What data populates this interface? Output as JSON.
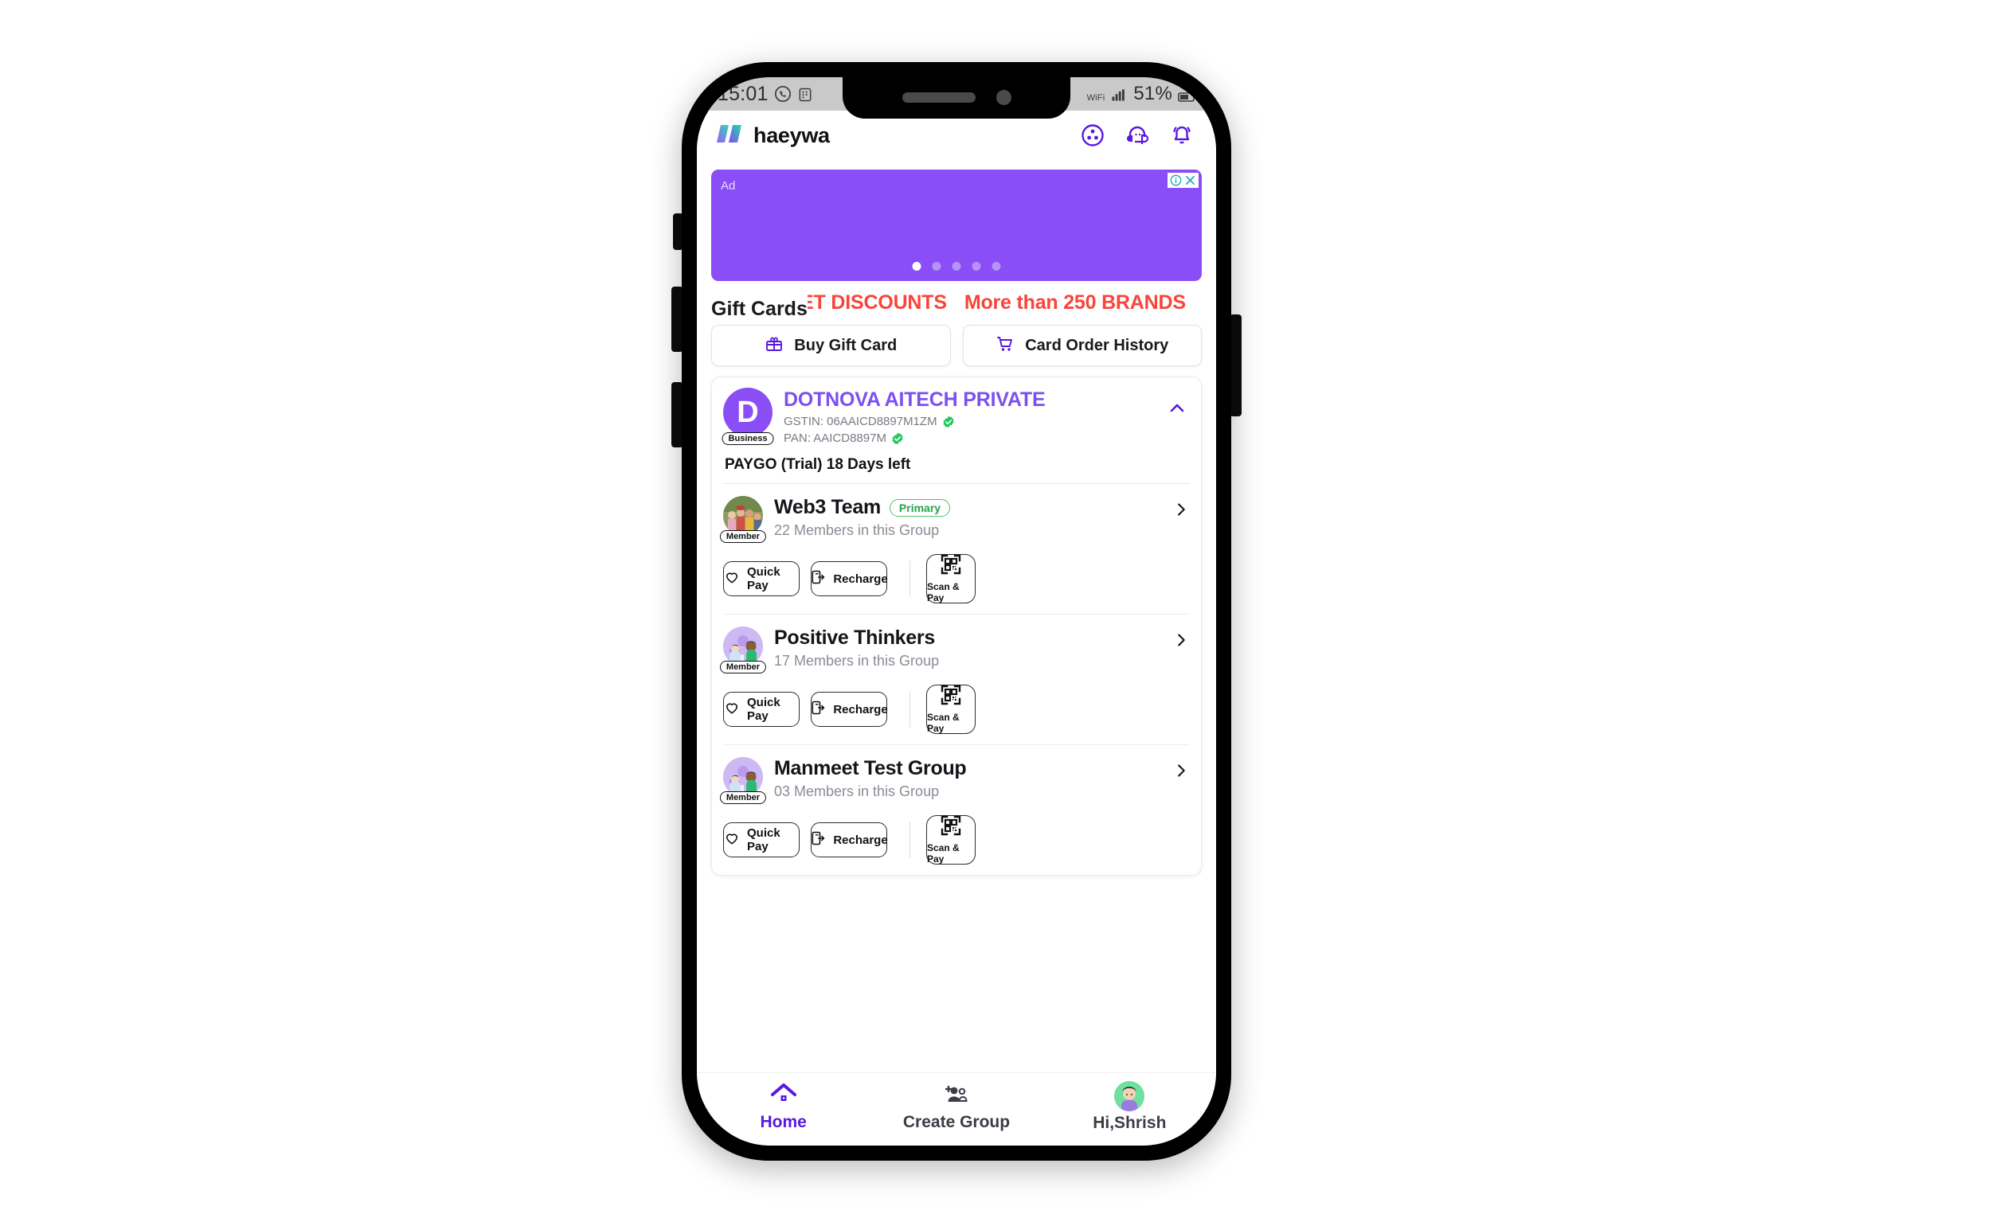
{
  "status_bar": {
    "time": "15:01",
    "icons": [
      "whatsapp-icon",
      "app-notification-icon"
    ],
    "wifi_label": "WiFi",
    "battery_percent": "51%"
  },
  "header": {
    "brand_name": "haeywa",
    "actions": [
      {
        "name": "apps-circle-icon"
      },
      {
        "name": "support-headset-icon"
      },
      {
        "name": "notification-bell-icon"
      }
    ]
  },
  "ad": {
    "label": "Ad",
    "info_icon": "info-icon",
    "close_icon": "close-icon",
    "dot_count": 5,
    "active_dot": 0,
    "background_color": "#8b4df5"
  },
  "gift_cards": {
    "title": "Gift Cards",
    "marquee": [
      "GET DISCOUNTS",
      "More than 250 BRANDS"
    ],
    "marquee_color": "#f8453a",
    "buttons": [
      {
        "label": "Buy Gift Card",
        "icon": "gift-icon"
      },
      {
        "label": "Card Order History",
        "icon": "cart-icon"
      }
    ]
  },
  "business": {
    "avatar_letter": "D",
    "avatar_tag": "Business",
    "name": "DOTNOVA AITECH PRIVATE",
    "gstin": "GSTIN: 06AAICD8897M1ZM",
    "pan": "PAN: AAICD8897M",
    "verified_icon": "verified-check-icon",
    "collapse_icon": "chevron-up-icon",
    "plan": "PAYGO (Trial) 18 Days left",
    "accent_color": "#7c4ff0"
  },
  "groups": [
    {
      "name": "Web3 Team",
      "badge": "Primary",
      "members": "22 Members in this Group",
      "member_tag": "Member",
      "avatar": "group-photo-avatar",
      "chevron": "chevron-right-icon",
      "actions": [
        {
          "label": "Quick Pay",
          "icon": "heart-icon"
        },
        {
          "label": "Recharge",
          "icon": "mobile-recharge-icon"
        }
      ],
      "scan_pay": {
        "label": "Scan & Pay",
        "icon": "qr-code-icon"
      }
    },
    {
      "name": "Positive Thinkers",
      "badge": "",
      "members": "17 Members in this Group",
      "member_tag": "Member",
      "avatar": "people-illustration-avatar",
      "chevron": "chevron-right-icon",
      "actions": [
        {
          "label": "Quick Pay",
          "icon": "heart-icon"
        },
        {
          "label": "Recharge",
          "icon": "mobile-recharge-icon"
        }
      ],
      "scan_pay": {
        "label": "Scan & Pay",
        "icon": "qr-code-icon"
      }
    },
    {
      "name": "Manmeet Test Group",
      "badge": "",
      "members": "03 Members in this Group",
      "member_tag": "Member",
      "avatar": "people-illustration-avatar",
      "chevron": "chevron-right-icon",
      "actions": [
        {
          "label": "Quick Pay",
          "icon": "heart-icon"
        },
        {
          "label": "Recharge",
          "icon": "mobile-recharge-icon"
        }
      ],
      "scan_pay": {
        "label": "Scan & Pay",
        "icon": "qr-code-icon"
      }
    }
  ],
  "bottom_nav": {
    "items": [
      {
        "label": "Home",
        "icon": "home-icon",
        "active": true
      },
      {
        "label": "Create Group",
        "icon": "add-group-icon",
        "active": false
      },
      {
        "label": "Hi,Shrish",
        "icon": "user-avatar",
        "active": false
      }
    ],
    "active_color": "#5a18e0"
  }
}
